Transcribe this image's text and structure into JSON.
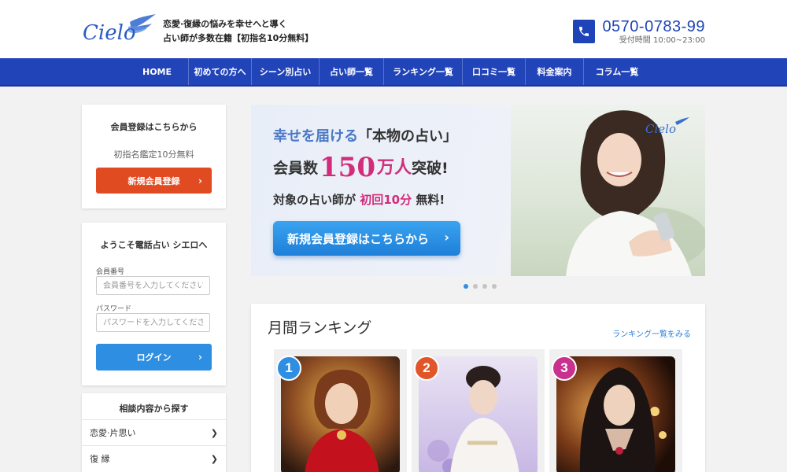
{
  "header": {
    "logo_text": "Cielo",
    "tagline_line1": "恋愛·復縁の悩みを幸せへと導く",
    "tagline_line2": "占い師が多数在籍【初指名10分無料】",
    "phone_number": "0570-0783-99",
    "phone_hours": "受付時間 10:00~23:00",
    "phone_icon": "phone-icon"
  },
  "nav": {
    "items": [
      {
        "label": "HOME"
      },
      {
        "label": "初めての方へ"
      },
      {
        "label": "シーン別占い"
      },
      {
        "label": "占い師一覧"
      },
      {
        "label": "ランキング一覧"
      },
      {
        "label": "口コミ一覧"
      },
      {
        "label": "料金案内"
      },
      {
        "label": "コラム一覧"
      }
    ]
  },
  "sidebar": {
    "register": {
      "title": "会員登録はこちらから",
      "sub": "初指名鑑定10分無料",
      "button": "新規会員登録"
    },
    "login": {
      "title": "ようこそ電話占い シエロへ",
      "member_label": "会員番号",
      "member_placeholder": "会員番号を入力してください",
      "password_label": "パスワード",
      "password_placeholder": "パスワードを入力してください",
      "button": "ログイン"
    },
    "categories": {
      "title": "相談内容から探す",
      "items": [
        {
          "label": "恋愛·片思い"
        },
        {
          "label": "復 縁"
        }
      ]
    }
  },
  "banner": {
    "line1_a": "幸せを届ける",
    "line1_b": "「本物の占い」",
    "line2_a": "会員数",
    "line2_num": "150",
    "line2_unit": "万人",
    "line2_b": "突破!",
    "line3_a": "対象の占い師が",
    "line3_b": "初回10分",
    "line3_c": "無料!",
    "cta": "新規会員登録はこちらから",
    "logo_text": "Cielo",
    "slide_count": 4,
    "active_slide": 1
  },
  "ranking": {
    "title": "月間ランキング",
    "more_link": "ランキング一覧をみる",
    "items": [
      {
        "rank": "1",
        "badge_color": "#2e8ee2"
      },
      {
        "rank": "2",
        "badge_color": "#e0562a"
      },
      {
        "rank": "3",
        "badge_color": "#c9318e"
      }
    ]
  },
  "colors": {
    "brand_blue": "#2244b9",
    "button_red": "#e04b22",
    "button_blue": "#2e8ee2",
    "accent_pink": "#d22c7a"
  }
}
